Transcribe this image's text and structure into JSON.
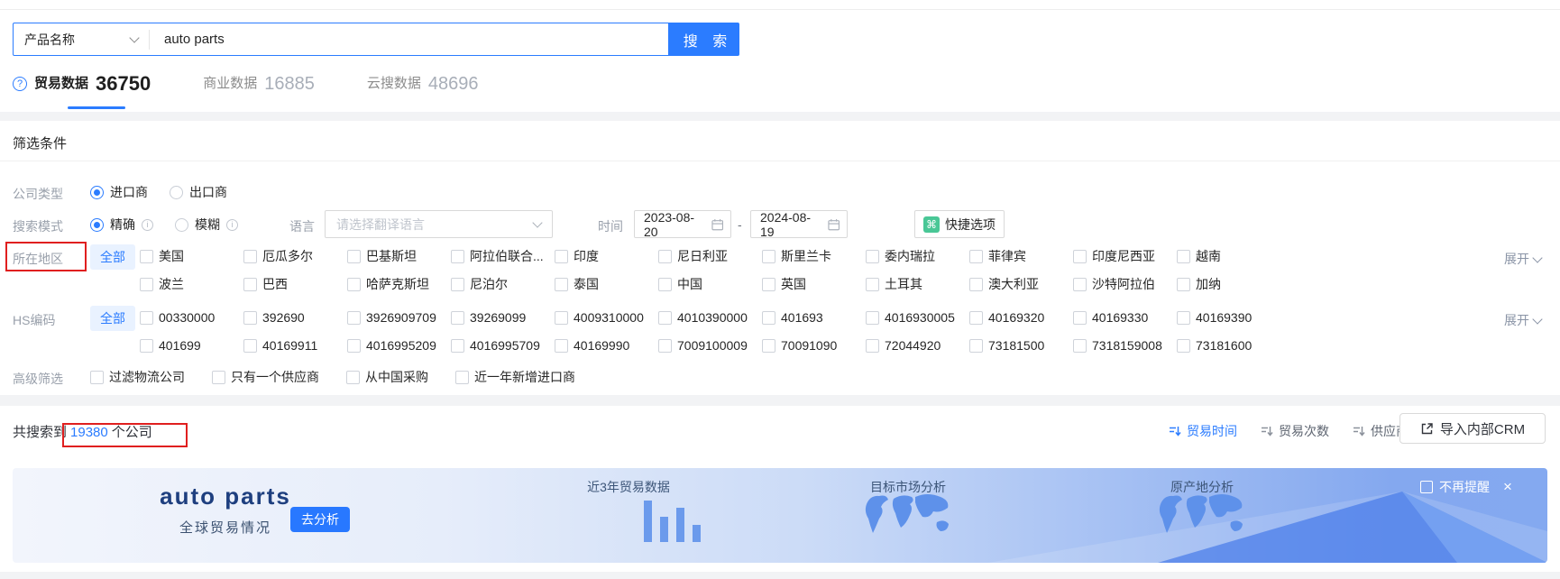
{
  "colors": {
    "primary": "#2b7cff",
    "annotation_red": "#e01f1f",
    "all_tag_bg": "#e9f2ff",
    "quick_icon_green": "#49c796",
    "banner_title": "#1e3f7f",
    "banner_bar": "#6b9aec"
  },
  "search": {
    "category_label": "产品名称",
    "query": "auto parts",
    "button_label": "搜 索"
  },
  "tabs": [
    {
      "label": "贸易数据",
      "count": "36750"
    },
    {
      "label": "商业数据",
      "count": "16885"
    },
    {
      "label": "云搜数据",
      "count": "48696"
    }
  ],
  "filters": {
    "title": "筛选条件",
    "company_type_label": "公司类型",
    "company_type_options": [
      "进口商",
      "出口商"
    ],
    "search_mode_label": "搜索模式",
    "search_mode_options": [
      "精确",
      "模糊"
    ],
    "language_label": "语言",
    "language_placeholder": "请选择翻译语言",
    "time_label": "时间",
    "time_start": "2023-08-20",
    "time_separator": "-",
    "time_end": "2024-08-19",
    "quick_options_label": "快捷选项",
    "all_label": "全部",
    "expand_label": "展开",
    "region_label": "所在地区",
    "region_row1": [
      "美国",
      "厄瓜多尔",
      "巴基斯坦",
      "阿拉伯联合...",
      "印度",
      "尼日利亚",
      "斯里兰卡",
      "委内瑞拉",
      "菲律宾",
      "印度尼西亚",
      "越南"
    ],
    "region_row2": [
      "波兰",
      "巴西",
      "哈萨克斯坦",
      "尼泊尔",
      "泰国",
      "中国",
      "英国",
      "土耳其",
      "澳大利亚",
      "沙特阿拉伯",
      "加纳"
    ],
    "hs_label": "HS编码",
    "hs_row1": [
      "00330000",
      "392690",
      "3926909709",
      "39269099",
      "4009310000",
      "4010390000",
      "401693",
      "4016930005",
      "40169320",
      "40169330",
      "40169390"
    ],
    "hs_row2": [
      "401699",
      "40169911",
      "4016995209",
      "4016995709",
      "40169990",
      "7009100009",
      "70091090",
      "72044920",
      "73181500",
      "7318159008",
      "73181600"
    ],
    "advanced_label": "高级筛选",
    "advanced_options": [
      "过滤物流公司",
      "只有一个供应商",
      "从中国采购",
      "近一年新增进口商"
    ]
  },
  "results": {
    "prefix": "共搜索到",
    "count": "19380",
    "suffix": "个公司",
    "sorts": [
      "贸易时间",
      "贸易次数",
      "供应商数"
    ],
    "crm_button": "导入内部CRM"
  },
  "banner": {
    "title": "auto parts",
    "subtitle": "全球贸易情况",
    "cta": "去分析",
    "card1": "近3年贸易数据",
    "card2": "目标市场分析",
    "card3": "原产地分析",
    "dismiss": "不再提醒",
    "close": "×",
    "chart": {
      "type": "bar",
      "values": [
        46,
        28,
        38,
        19
      ]
    }
  }
}
